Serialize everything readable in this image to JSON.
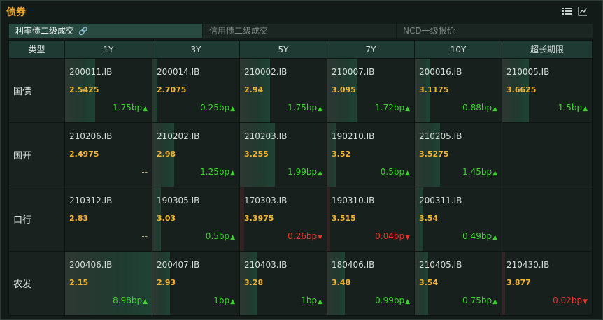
{
  "panel": {
    "title": "债券"
  },
  "header_icons": {
    "list_icon": "list-icon",
    "chart_icon": "line-chart-icon"
  },
  "tabs": [
    {
      "label": "利率债二级成交",
      "active": true,
      "icon": "link-icon",
      "icon_glyph": "🔗"
    },
    {
      "label": "信用债二级成交",
      "active": false
    },
    {
      "label": "NCD一级报价",
      "active": false
    }
  ],
  "table": {
    "columns": [
      "类型",
      "1Y",
      "3Y",
      "5Y",
      "7Y",
      "10Y",
      "超长期限"
    ],
    "rows": [
      {
        "type": "国债",
        "cells": [
          {
            "code": "200011.IB",
            "rate": "2.5425",
            "change": "1.75bp",
            "dir": "up",
            "level": 0.35
          },
          {
            "code": "200014.IB",
            "rate": "2.7075",
            "change": "0.25bp",
            "dir": "up",
            "level": 0.05
          },
          {
            "code": "210002.IB",
            "rate": "2.94",
            "change": "1.75bp",
            "dir": "up",
            "level": 0.35
          },
          {
            "code": "210007.IB",
            "rate": "3.095",
            "change": "1.72bp",
            "dir": "up",
            "level": 0.34
          },
          {
            "code": "200016.IB",
            "rate": "3.1175",
            "change": "0.88bp",
            "dir": "up",
            "level": 0.18
          },
          {
            "code": "210005.IB",
            "rate": "3.6625",
            "change": "1.5bp",
            "dir": "up",
            "level": 0.3
          }
        ]
      },
      {
        "type": "国开",
        "cells": [
          {
            "code": "210206.IB",
            "rate": "2.4975",
            "change": "--",
            "dir": "none",
            "level": 0
          },
          {
            "code": "210202.IB",
            "rate": "2.98",
            "change": "1.25bp",
            "dir": "up",
            "level": 0.25
          },
          {
            "code": "210203.IB",
            "rate": "3.255",
            "change": "1.99bp",
            "dir": "up",
            "level": 0.4
          },
          {
            "code": "190210.IB",
            "rate": "3.52",
            "change": "0.5bp",
            "dir": "up",
            "level": 0.1
          },
          {
            "code": "210205.IB",
            "rate": "3.5275",
            "change": "1.45bp",
            "dir": "up",
            "level": 0.29
          },
          {
            "code": "",
            "rate": "",
            "change": "",
            "dir": "none",
            "level": 0
          }
        ]
      },
      {
        "type": "口行",
        "cells": [
          {
            "code": "210312.IB",
            "rate": "2.83",
            "change": "--",
            "dir": "none",
            "level": 0
          },
          {
            "code": "190305.IB",
            "rate": "3.03",
            "change": "0.5bp",
            "dir": "up",
            "level": 0.1
          },
          {
            "code": "170303.IB",
            "rate": "3.3975",
            "change": "0.26bp",
            "dir": "down",
            "level": 0.05
          },
          {
            "code": "190310.IB",
            "rate": "3.515",
            "change": "0.04bp",
            "dir": "down",
            "level": 0.01
          },
          {
            "code": "200311.IB",
            "rate": "3.54",
            "change": "0.49bp",
            "dir": "up",
            "level": 0.1
          },
          {
            "code": "",
            "rate": "",
            "change": "",
            "dir": "none",
            "level": 0
          }
        ]
      },
      {
        "type": "农发",
        "cells": [
          {
            "code": "200406.IB",
            "rate": "2.15",
            "change": "8.98bp",
            "dir": "up",
            "level": 1.0
          },
          {
            "code": "200407.IB",
            "rate": "2.93",
            "change": "1bp",
            "dir": "up",
            "level": 0.2
          },
          {
            "code": "210403.IB",
            "rate": "3.28",
            "change": "1bp",
            "dir": "up",
            "level": 0.2
          },
          {
            "code": "180406.IB",
            "rate": "3.48",
            "change": "0.99bp",
            "dir": "up",
            "level": 0.2
          },
          {
            "code": "210405.IB",
            "rate": "3.54",
            "change": "0.75bp",
            "dir": "up",
            "level": 0.15
          },
          {
            "code": "210430.IB",
            "rate": "3.877",
            "change": "0.02bp",
            "dir": "down",
            "level": 0.0
          }
        ]
      }
    ]
  },
  "colors": {
    "accent": "#f0a833",
    "up": "#3cd32d",
    "down": "#e8332a",
    "rate": "#f3b431",
    "header_bg": "#1f3a33"
  }
}
